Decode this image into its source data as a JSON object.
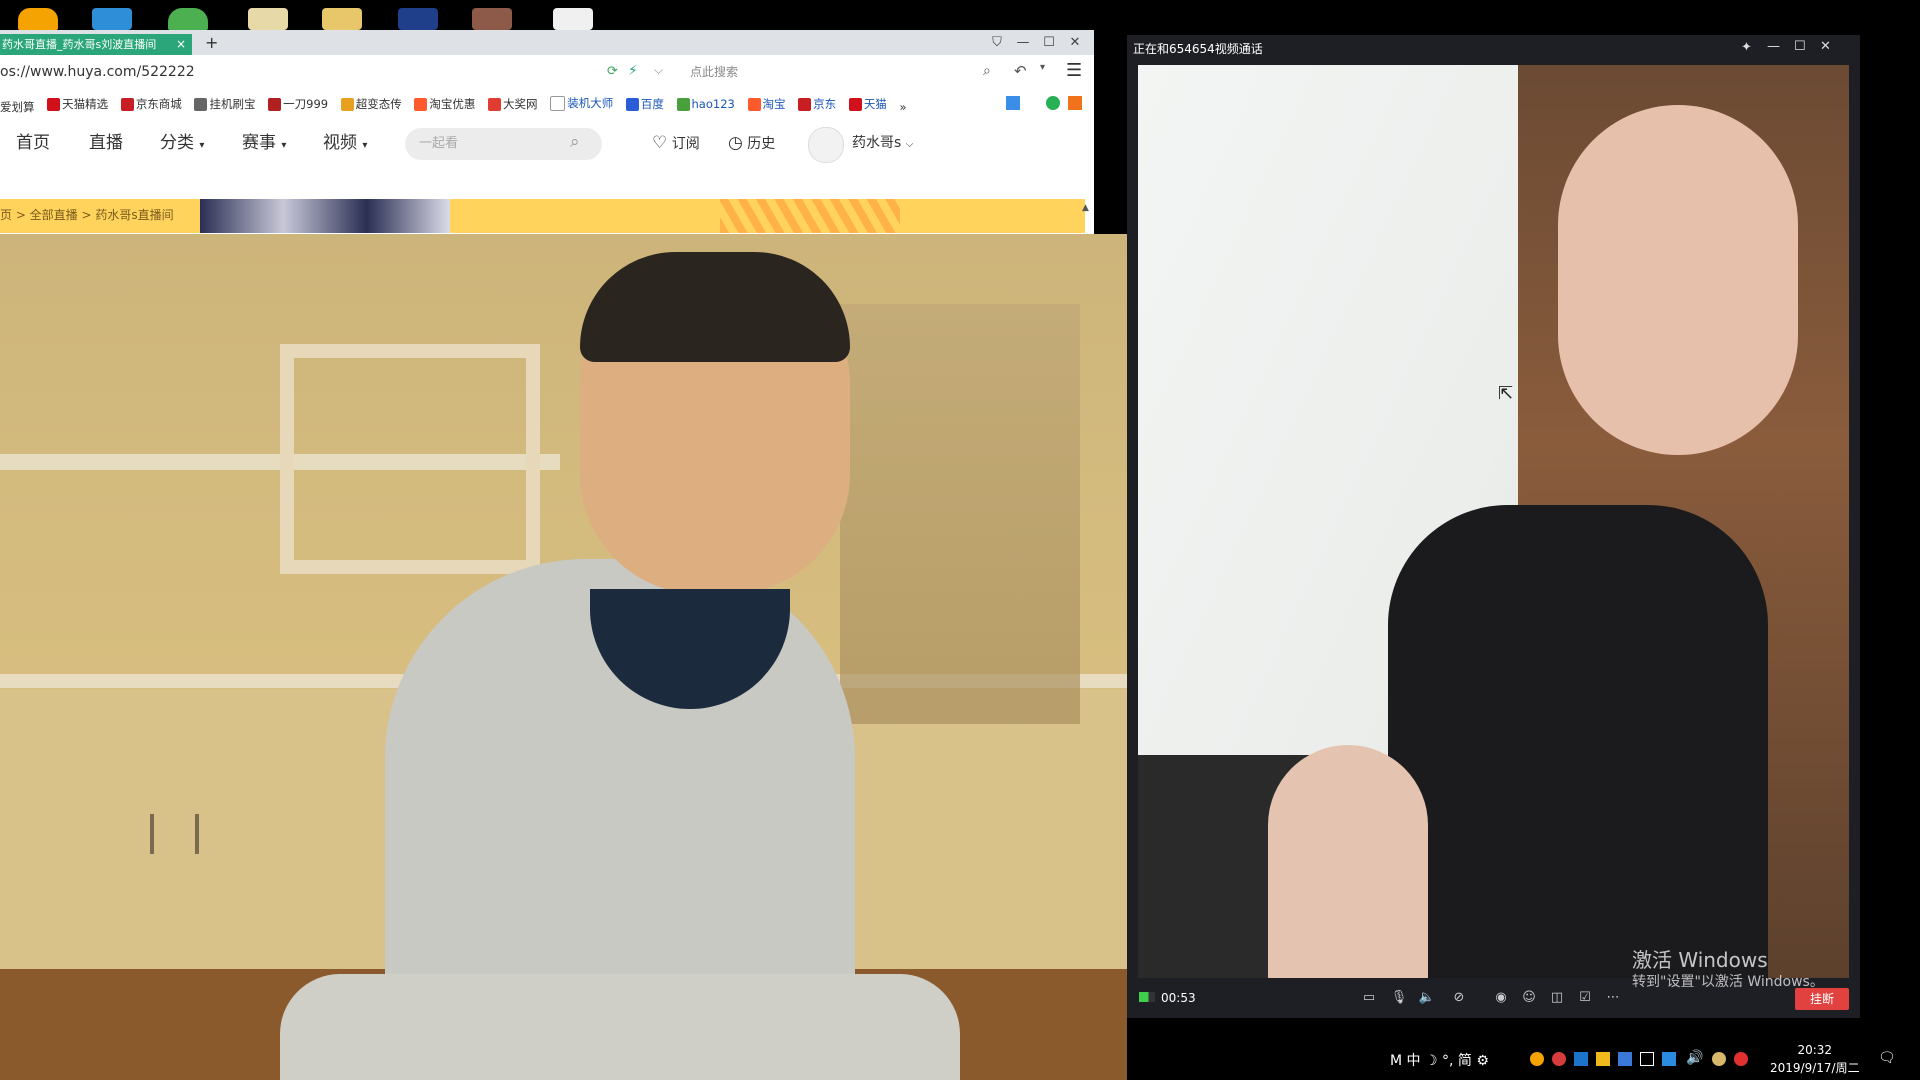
{
  "browser": {
    "tab_title": "药水哥直播_药水哥s刘波直播间",
    "tab_close": "×",
    "new_tab": "+",
    "url": "os://www.huya.com/522222",
    "search_placeholder": "点此搜索",
    "bookmarks": [
      "爱划算",
      "天猫精选",
      "京东商城",
      "挂机刷宝",
      "一刀999",
      "超变态传",
      "淘宝优惠",
      "大奖网",
      "装机大师",
      "百度",
      "hao123",
      "淘宝",
      "京东",
      "天猫"
    ],
    "bookmarks_more": "»"
  },
  "site": {
    "nav": [
      "首页",
      "直播",
      "分类",
      "赛事",
      "视频"
    ],
    "search_placeholder": "一起看",
    "subscribe": "订阅",
    "history": "历史",
    "username": "药水哥s",
    "breadcrumb": "页 > 全部直播 > 药水哥s直播间"
  },
  "call": {
    "title": "正在和654654视频通话",
    "timer": "00:53",
    "hangup": "挂断"
  },
  "watermark": {
    "line1": "激活 Windows",
    "line2": "转到\"设置\"以激活 Windows。"
  },
  "tray": {
    "ime": "M 中 ☽ °, 简 ⚙",
    "time": "20:32",
    "date": "2019/9/17/周二"
  },
  "colors": {
    "tab_green": "#2aa67a",
    "hangup_red": "#e2423f",
    "huya_yellow": "#ffd35c"
  }
}
